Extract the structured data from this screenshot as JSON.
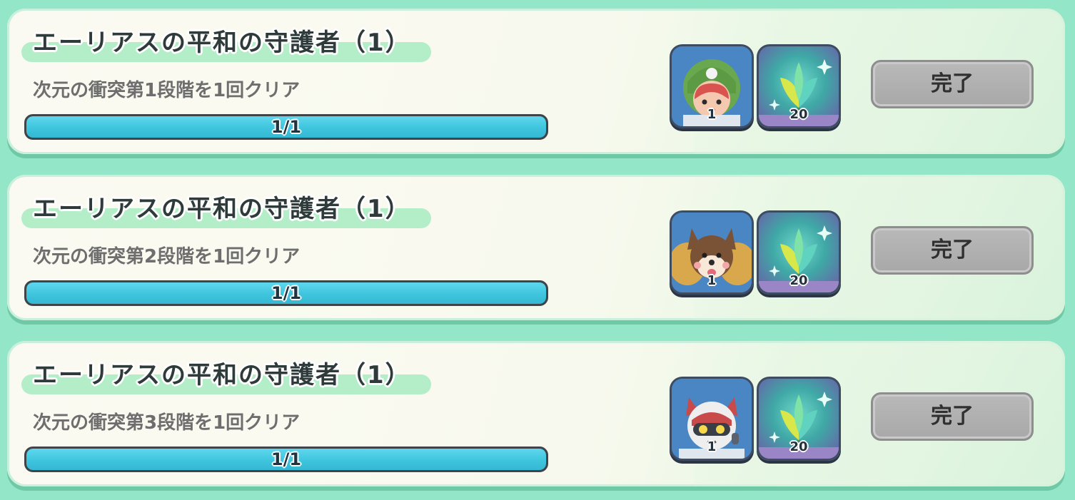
{
  "quests": [
    {
      "title": "エーリアスの平和の守護者（1）",
      "description": "次元の衝突第1段階を1回クリア",
      "progress_text": "1/1",
      "progress": 1.0,
      "rewards": [
        {
          "icon": "hero-green-hood-girl-icon",
          "count": "1"
        },
        {
          "icon": "rainbow-leaf-icon",
          "count": "20"
        }
      ],
      "button_label": "完了"
    },
    {
      "title": "エーリアスの平和の守護者（1）",
      "description": "次元の衝突第2段階を1回クリア",
      "progress_text": "1/1",
      "progress": 1.0,
      "rewards": [
        {
          "icon": "hero-fox-icon",
          "count": "1"
        },
        {
          "icon": "rainbow-leaf-icon",
          "count": "20"
        }
      ],
      "button_label": "完了"
    },
    {
      "title": "エーリアスの平和の守護者（1）",
      "description": "次元の衝突第3段階を1回クリア",
      "progress_text": "1/1",
      "progress": 1.0,
      "rewards": [
        {
          "icon": "hero-robot-cat-icon",
          "count": "1"
        },
        {
          "icon": "rainbow-leaf-icon",
          "count": "20"
        }
      ],
      "button_label": "完了"
    }
  ],
  "colors": {
    "background": "#94e6c9",
    "progress_fill": "#3ec5dd",
    "button_disabled": "#aaaaaa",
    "title_band": "#b4eec8"
  }
}
